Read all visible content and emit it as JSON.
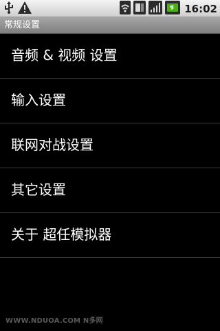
{
  "status_bar": {
    "time": "16:02",
    "icons_left": [
      "usb-icon",
      "warning-icon"
    ],
    "icons_right": [
      "wifi-icon",
      "sim-icon",
      "signal-icon",
      "battery-icon"
    ]
  },
  "title_bar": {
    "title": "常规设置"
  },
  "menu": {
    "items": [
      {
        "label": "音频 & 视频 设置"
      },
      {
        "label": "输入设置"
      },
      {
        "label": "联网对战设置"
      },
      {
        "label": "其它设置"
      },
      {
        "label": "关于 超任模拟器"
      }
    ]
  },
  "watermark": {
    "text": "WWW.NDUOA.COM N多网"
  },
  "colors": {
    "background": "#000000",
    "status_bar": "#dcdcdc",
    "title_bar": "#8f8f8f",
    "divider": "#3a3a3a",
    "text": "#ffffff",
    "battery_accent": "#4caf1a"
  }
}
